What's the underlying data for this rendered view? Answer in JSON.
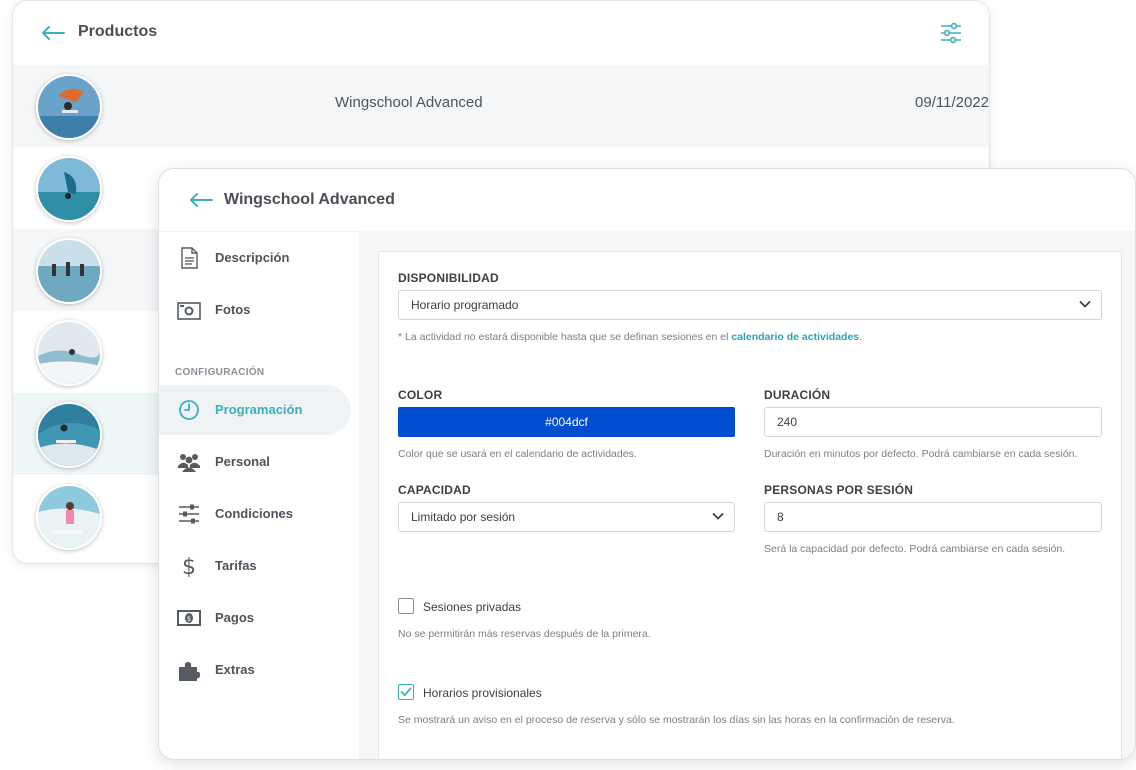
{
  "back_window": {
    "title": "Productos",
    "products": [
      {
        "name": "Wingschool Advanced",
        "date": "09/11/2022"
      },
      {
        "name": "",
        "date": ""
      },
      {
        "name": "",
        "date": ""
      },
      {
        "name": "",
        "date": ""
      },
      {
        "name": "",
        "date": ""
      },
      {
        "name": "",
        "date": ""
      }
    ]
  },
  "front_window": {
    "title": "Wingschool Advanced",
    "sidebar": {
      "top_items": [
        {
          "label": "Descripción",
          "icon": "document-icon"
        },
        {
          "label": "Fotos",
          "icon": "camera-icon"
        }
      ],
      "section_label": "CONFIGURACIÓN",
      "config_items": [
        {
          "label": "Programación",
          "icon": "clock-icon"
        },
        {
          "label": "Personal",
          "icon": "people-icon"
        },
        {
          "label": "Condiciones",
          "icon": "sliders-icon"
        },
        {
          "label": "Tarifas",
          "icon": "dollar-icon"
        },
        {
          "label": "Pagos",
          "icon": "banknote-icon"
        },
        {
          "label": "Extras",
          "icon": "puzzle-icon"
        }
      ]
    },
    "form": {
      "disponibilidad": {
        "label": "DISPONIBILIDAD",
        "value": "Horario programado",
        "help_prefix": "* La actividad no estará disponible hasta que se definan sesiones en el ",
        "help_link": "calendario de actividades",
        "help_suffix": "."
      },
      "color": {
        "label": "COLOR",
        "value": "#004dcf",
        "help": "Color que se usará en el calendario de actividades."
      },
      "duracion": {
        "label": "DURACIÓN",
        "value": "240",
        "help": "Duración en minutos por defecto. Podrá cambiarse en cada sesión."
      },
      "capacidad": {
        "label": "CAPACIDAD",
        "value": "Limitado por sesión"
      },
      "personas": {
        "label": "PERSONAS POR SESIÓN",
        "value": "8",
        "help": "Será la capacidad por defecto. Podrá cambiarse en cada sesión."
      },
      "sesiones_privadas": {
        "label": "Sesiones privadas",
        "checked": false,
        "help": "No se permitirán más reservas después de la primera."
      },
      "horarios_provisionales": {
        "label": "Horarios provisionales",
        "checked": true,
        "help": "Se mostrará un aviso en el proceso de reserva y sólo se mostrarán los días sin las horas en la confirmación de reserva."
      }
    }
  },
  "colors": {
    "accent": "#3ab0bf",
    "color_value": "#004dcf"
  }
}
